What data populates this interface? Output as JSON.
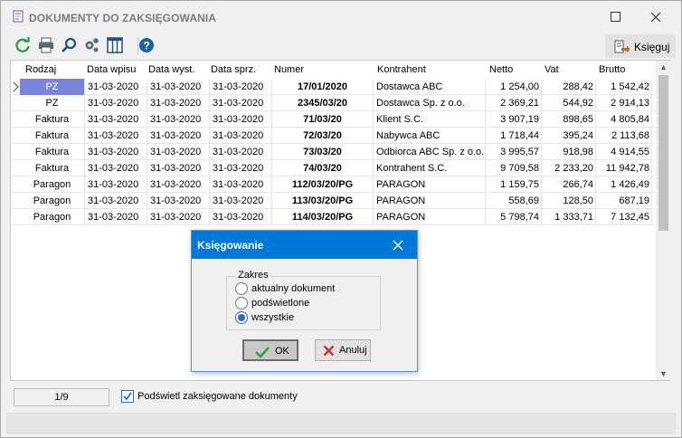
{
  "window": {
    "title": "DOKUMENTY DO ZAKSIĘGOWANIA"
  },
  "toolbar": {
    "icons": [
      "refresh-icon",
      "print-icon",
      "search-icon",
      "settings-icon",
      "columns-icon",
      "help-icon"
    ],
    "ksieguj_label": "Księguj"
  },
  "grid": {
    "headers": [
      "Rodzaj",
      "Data wpisu",
      "Data wyst.",
      "Data sprz.",
      "Numer",
      "Kontrahent",
      "Netto",
      "Vat",
      "Brutto"
    ],
    "rows": [
      [
        "PZ",
        "31-03-2020",
        "31-03-2020",
        "31-03-2020",
        "17/01/2020",
        "Dostawca ABC",
        "1 254,00",
        "288,42",
        "1 542,42"
      ],
      [
        "PZ",
        "31-03-2020",
        "31-03-2020",
        "31-03-2020",
        "2345/03/20",
        "Dostawca Sp. z o.o.",
        "2 369,21",
        "544,92",
        "2 914,13"
      ],
      [
        "Faktura",
        "31-03-2020",
        "31-03-2020",
        "31-03-2020",
        "71/03/20",
        "Klient S.C.",
        "3 907,19",
        "898,65",
        "4 805,84"
      ],
      [
        "Faktura",
        "31-03-2020",
        "31-03-2020",
        "31-03-2020",
        "72/03/20",
        "Nabywca ABC",
        "1 718,44",
        "395,24",
        "2 113,68"
      ],
      [
        "Faktura",
        "31-03-2020",
        "31-03-2020",
        "31-03-2020",
        "73/03/20",
        "Odbiorca ABC Sp. z o.o.",
        "3 995,57",
        "918,98",
        "4 914,55"
      ],
      [
        "Faktura",
        "31-03-2020",
        "31-03-2020",
        "31-03-2020",
        "74/03/20",
        "Kontrahent S.C.",
        "9 709,58",
        "2 233,20",
        "11 942,78"
      ],
      [
        "Paragon",
        "31-03-2020",
        "31-03-2020",
        "31-03-2020",
        "112/03/20/PG",
        "PARAGON",
        "1 159,75",
        "266,74",
        "1 426,49"
      ],
      [
        "Paragon",
        "31-03-2020",
        "31-03-2020",
        "31-03-2020",
        "113/03/20/PG",
        "PARAGON",
        "558,69",
        "128,50",
        "687,19"
      ],
      [
        "Paragon",
        "31-03-2020",
        "31-03-2020",
        "31-03-2020",
        "114/03/20/PG",
        "PARAGON",
        "5 798,74",
        "1 333,71",
        "7 132,45"
      ]
    ],
    "selected_row": 0,
    "selected_color": "#7a85d9"
  },
  "status": {
    "record_counter": "1/9",
    "highlight_checked": true,
    "highlight_label": "Podświetl zaksięgowane dokumenty"
  },
  "dialog": {
    "title": "Księgowanie",
    "title_bar_color": "#0078d7",
    "group_label": "Zakres",
    "options": [
      {
        "label": "aktualny dokument",
        "checked": false
      },
      {
        "label": "podświetlone",
        "checked": false
      },
      {
        "label": "wszystkie",
        "checked": true
      }
    ],
    "ok_label": "OK",
    "cancel_label": "Anuluj"
  }
}
